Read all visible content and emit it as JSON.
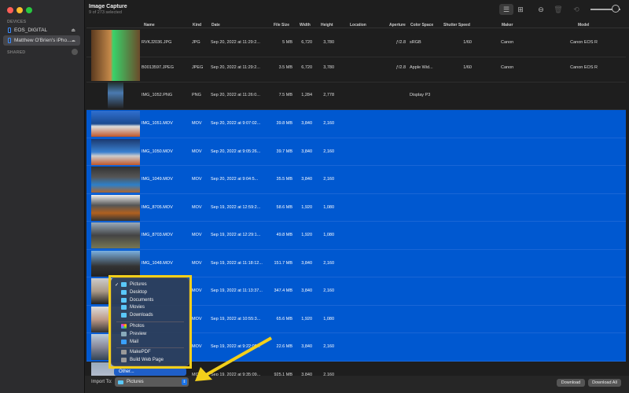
{
  "window": {
    "title": "Image Capture",
    "subtitle": "9 of 273 selected"
  },
  "sidebar": {
    "devices_label": "DEVICES",
    "shared_label": "SHARED",
    "devices": [
      {
        "label": "EOS_DIGITAL",
        "icon": "eject-icon"
      },
      {
        "label": "Matthew O'Brien's iPho...",
        "icon": "cloud-icon"
      }
    ]
  },
  "toolbar": {
    "list_view": "list-icon",
    "grid_view": "grid-icon",
    "rotate": "rotate-icon",
    "delete": "trash-icon",
    "minus": "minus-circle-icon",
    "thumbnail_size_level": 0.75
  },
  "columns": [
    "Name",
    "Kind",
    "Date",
    "File Size",
    "Width",
    "Height",
    "Location",
    "Aperture",
    "Color Space",
    "Shutter Speed",
    "Maker",
    "Model"
  ],
  "rows": [
    {
      "name": "RVKJ2036.JPG",
      "kind": "JPG",
      "date": "Sep 20, 2022 at 11:29:2...",
      "size": "5 MB",
      "width": "6,720",
      "height": "3,780",
      "aperture": "ƒ/2.8",
      "color_space": "sRGB",
      "shutter": "1/60",
      "maker": "Canon",
      "model": "Canon EOS R",
      "selected": false
    },
    {
      "name": "B0013597.JPEG",
      "kind": "JPEG",
      "date": "Sep 20, 2022 at 11:29:2...",
      "size": "3.5 MB",
      "width": "6,720",
      "height": "3,780",
      "aperture": "ƒ/2.8",
      "color_space": "Apple Wid...",
      "shutter": "1/60",
      "maker": "Canon",
      "model": "Canon EOS R",
      "selected": false
    },
    {
      "name": "IMG_1052.PNG",
      "kind": "PNG",
      "date": "Sep 20, 2022 at 11:26:0...",
      "size": "7.5 MB",
      "width": "1,284",
      "height": "2,778",
      "color_space": "Display P3",
      "selected": false
    },
    {
      "name": "IMG_1051.MOV",
      "kind": "MOV",
      "date": "Sep 20, 2022 at 9:07:02...",
      "size": "39.8 MB",
      "width": "3,840",
      "height": "2,160",
      "selected": true
    },
    {
      "name": "IMG_1050.MOV",
      "kind": "MOV",
      "date": "Sep 20, 2022 at 9:05:26...",
      "size": "39.7 MB",
      "width": "3,840",
      "height": "2,160",
      "selected": true
    },
    {
      "name": "IMG_1049.MOV",
      "kind": "MOV",
      "date": "Sep 20, 2022 at 9:04:5...",
      "size": "35.5 MB",
      "width": "3,840",
      "height": "2,160",
      "selected": true
    },
    {
      "name": "IMG_8705.MOV",
      "kind": "MOV",
      "date": "Sep 19, 2022 at 12:59:2...",
      "size": "58.6 MB",
      "width": "1,920",
      "height": "1,080",
      "selected": true
    },
    {
      "name": "IMG_8703.MOV",
      "kind": "MOV",
      "date": "Sep 19, 2022 at 12:29:1...",
      "size": "49.8 MB",
      "width": "1,920",
      "height": "1,080",
      "selected": true
    },
    {
      "name": "IMG_1048.MOV",
      "kind": "MOV",
      "date": "Sep 19, 2022 at 11:18:12...",
      "size": "151.7 MB",
      "width": "3,840",
      "height": "2,160",
      "selected": true
    },
    {
      "kind": "MOV",
      "date": "Sep 19, 2022 at 11:13:37...",
      "size": "347.4 MB",
      "width": "3,840",
      "height": "2,160",
      "selected": true
    },
    {
      "kind": "MOV",
      "date": "Sep 19, 2022 at 10:55:3...",
      "size": "65.6 MB",
      "width": "1,920",
      "height": "1,080",
      "selected": true
    },
    {
      "kind": "MOV",
      "date": "Sep 19, 2022 at 9:22:05...",
      "size": "22.6 MB",
      "width": "3,840",
      "height": "2,160",
      "selected": true
    },
    {
      "kind": "MOV",
      "date": "Sep 19, 2022 at 9:35:09...",
      "size": "925.1 MB",
      "width": "3,840",
      "height": "2,160",
      "selected": false
    }
  ],
  "footer": {
    "import_label": "Import To:",
    "import_value": "Pictures",
    "download": "Download",
    "download_all": "Download All"
  },
  "menu": {
    "folders": [
      "Pictures",
      "Desktop",
      "Documents",
      "Movies",
      "Downloads"
    ],
    "apps": [
      "Photos",
      "Preview",
      "Mail"
    ],
    "workflows": [
      "MakePDF",
      "Build Web Page"
    ],
    "other": "Other...",
    "checked": "Pictures"
  },
  "colors": {
    "selection": "#0058d0",
    "highlight": "#f2cf1a",
    "folder": "#5ac8fa"
  }
}
